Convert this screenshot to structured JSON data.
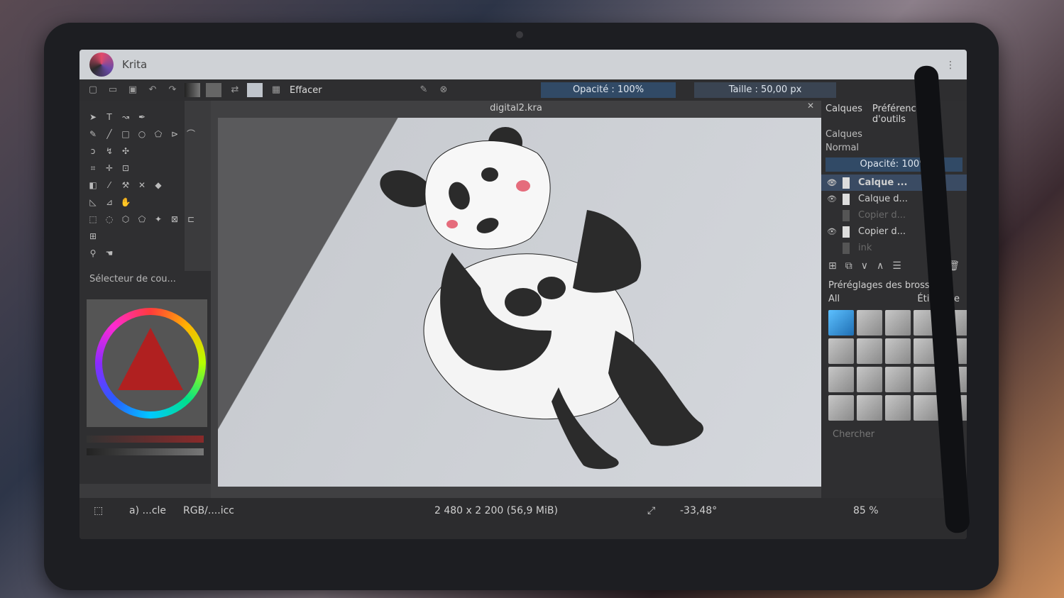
{
  "app": {
    "name": "Krita",
    "menu_icon": "kebab-icon"
  },
  "toolbar": {
    "brush_name": "Effacer",
    "opacity": "Opacité : 100%",
    "size": "Taille : 50,00 px"
  },
  "document": {
    "title": "digital2.kra"
  },
  "color_selector": {
    "title": "Sélecteur de cou..."
  },
  "layers_panel": {
    "tabs": [
      "Calques",
      "Préférences d'outils"
    ],
    "title": "Calques",
    "blend_mode": "Normal",
    "opacity": "Opacité: 100%",
    "layers": [
      {
        "name": "Calque ...",
        "visible": true,
        "active": true
      },
      {
        "name": "Calque d...",
        "visible": true,
        "active": false
      },
      {
        "name": "Copier d...",
        "visible": false,
        "active": false
      },
      {
        "name": "Copier d...",
        "visible": true,
        "active": false
      },
      {
        "name": "ink",
        "visible": false,
        "active": false
      }
    ]
  },
  "brush_presets": {
    "title": "Préréglages des brosses",
    "filter": "All",
    "tag": "Étiquette",
    "search_placeholder": "Chercher"
  },
  "status": {
    "profile_short": "a) ...cle",
    "color_profile": "RGB/....icc",
    "dimensions": "2 480 x 2 200 (56,9 MiB)",
    "rotation": "-33,48°",
    "zoom": "85 %"
  },
  "colors": {
    "accent": "#314a66",
    "canvas": "#d4d7dc",
    "panel": "#2f2f31"
  }
}
